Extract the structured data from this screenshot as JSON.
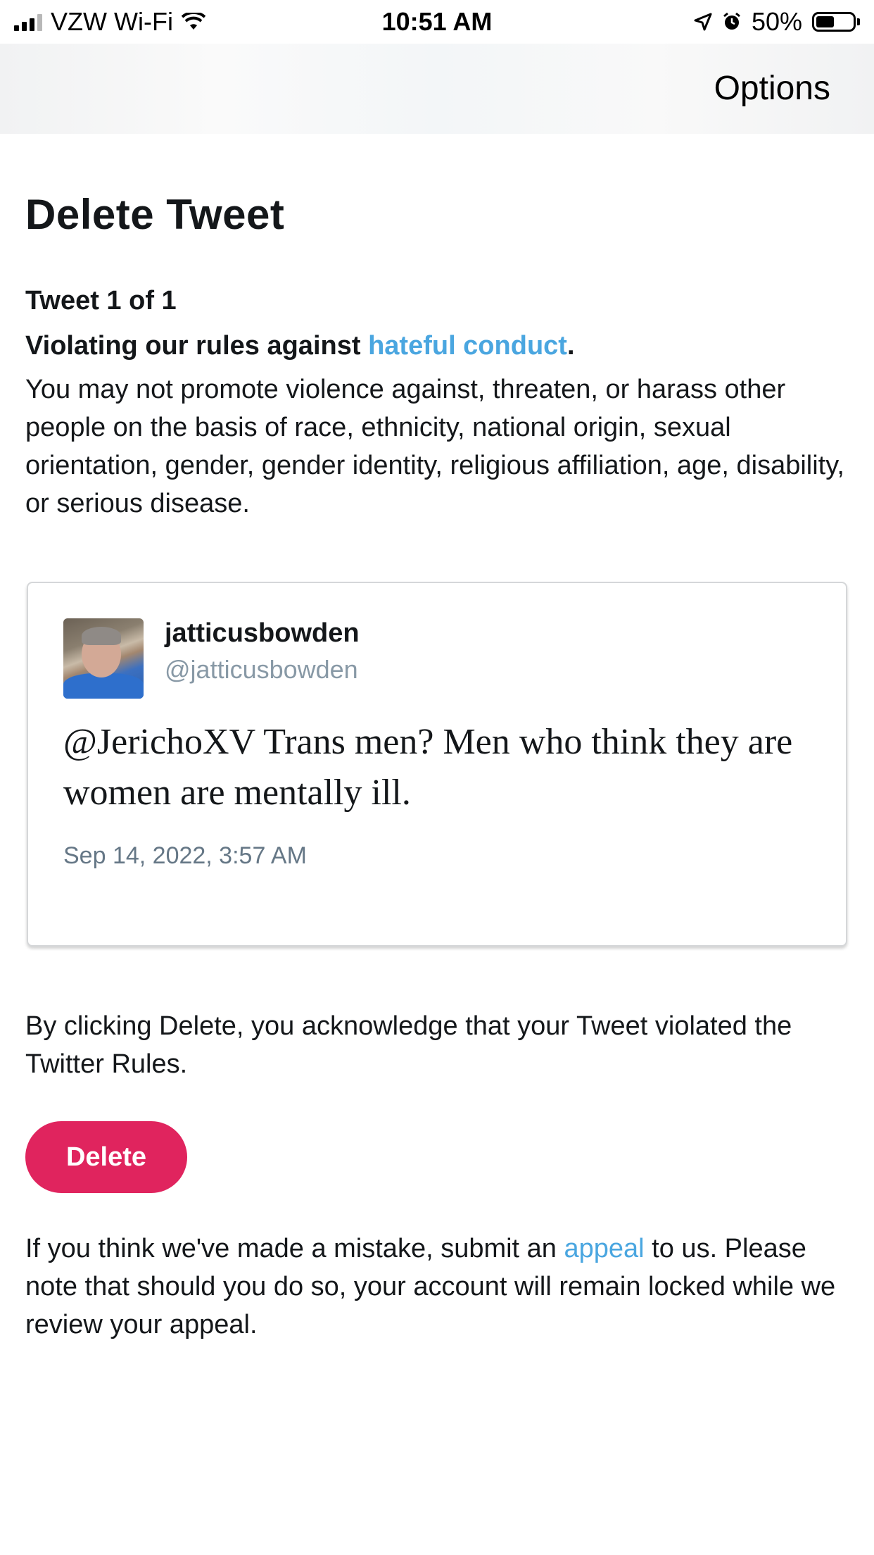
{
  "status_bar": {
    "carrier": "VZW Wi-Fi",
    "time": "10:51 AM",
    "battery_percent": "50%",
    "battery_level": 0.5,
    "icons": [
      "signal-icon",
      "wifi-icon",
      "location-icon",
      "alarm-icon",
      "battery-icon"
    ]
  },
  "nav": {
    "options_label": "Options"
  },
  "page": {
    "title": "Delete Tweet",
    "count": "Tweet 1 of 1",
    "violation_prefix": "Violating our rules against ",
    "violation_link": "hateful conduct",
    "violation_suffix": ".",
    "rule_text": "You may not promote violence against, threaten, or harass other people on the basis of race, ethnicity, national origin, sexual orientation, gender, gender identity, religious affiliation, age, disability, or serious disease."
  },
  "tweet": {
    "display_name": "jatticusbowden",
    "handle": "@jatticusbowden",
    "text": "@JerichoXV Trans men? Men who think they are women are mentally ill.",
    "timestamp": "Sep 14, 2022, 3:57 AM"
  },
  "acknowledge_text": "By clicking Delete, you acknowledge that your Tweet violated the Twitter Rules.",
  "delete_label": "Delete",
  "appeal": {
    "prefix": "If you think we've made a mistake, submit an ",
    "link": "appeal",
    "suffix": " to us. Please note that should you do so, your account will remain locked while we review your appeal."
  },
  "colors": {
    "link": "#4aa6e0",
    "delete_button": "#e0245e",
    "handle": "#8899a6"
  }
}
